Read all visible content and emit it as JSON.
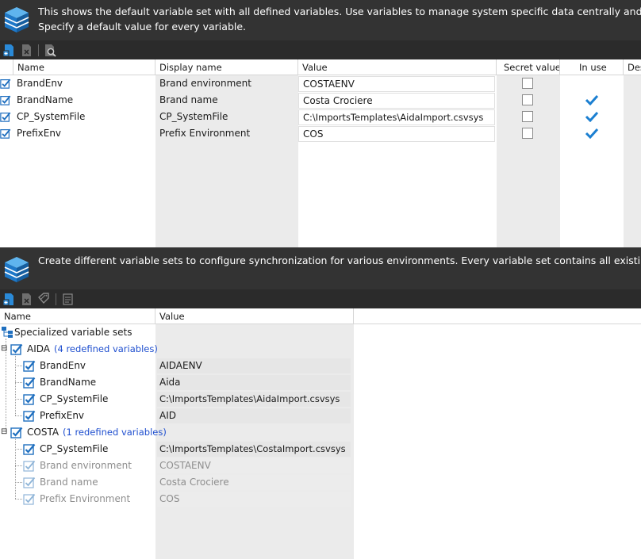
{
  "banner1": {
    "text_line1": "This shows the default variable set with all defined variables. Use variables to manage system specific data centrally and to pr",
    "text_line2": "Specify a default value for every variable."
  },
  "toolbar1": {
    "icons": [
      "add-variable-icon",
      "delete-variable-icon",
      "find-usages-icon"
    ]
  },
  "variables_table": {
    "columns": [
      "Name",
      "Display name",
      "Value",
      "Secret value",
      "In use",
      "Des"
    ],
    "rows": [
      {
        "name": "BrandEnv",
        "display_name": "Brand environment",
        "value": "COSTAENV",
        "secret": false,
        "in_use": false
      },
      {
        "name": "BrandName",
        "display_name": "Brand name",
        "value": "Costa Crociere",
        "secret": false,
        "in_use": true
      },
      {
        "name": "CP_SystemFile",
        "display_name": "CP_SystemFile",
        "value": "C:\\ImportsTemplates\\AidaImport.csvsys",
        "secret": false,
        "in_use": true
      },
      {
        "name": "PrefixEnv",
        "display_name": "Prefix Environment",
        "value": "COS",
        "secret": false,
        "in_use": true
      }
    ]
  },
  "banner2": {
    "text_line1": "Create different variable sets to configure synchronization for various environments. Every variable set contains all existing va"
  },
  "toolbar2": {
    "icons": [
      "add-set-icon",
      "delete-set-icon",
      "tag-icon",
      "edit-list-icon"
    ]
  },
  "sets_tree": {
    "columns": [
      "Name",
      "Value"
    ],
    "root_label": "Specialized variable sets",
    "sets": [
      {
        "name": "AIDA",
        "summary": "(4 redefined variables)",
        "items": [
          {
            "name": "BrandEnv",
            "value": "AIDAENV",
            "redefined": true
          },
          {
            "name": "BrandName",
            "value": "Aida",
            "redefined": true
          },
          {
            "name": "CP_SystemFile",
            "value": "C:\\ImportsTemplates\\AidaImport.csvsys",
            "redefined": true
          },
          {
            "name": "PrefixEnv",
            "value": "AID",
            "redefined": true
          }
        ]
      },
      {
        "name": "COSTA",
        "summary": "(1 redefined variables)",
        "items": [
          {
            "name": "CP_SystemFile",
            "value": "C:\\ImportsTemplates\\CostaImport.csvsys",
            "redefined": true
          },
          {
            "name": "Brand environment",
            "value": "COSTAENV",
            "redefined": false
          },
          {
            "name": "Brand name",
            "value": "Costa Crociere",
            "redefined": false
          },
          {
            "name": "Prefix Environment",
            "value": "COS",
            "redefined": false
          }
        ]
      }
    ]
  },
  "colors": {
    "banner_bg": "#333333",
    "toolbar_bg": "#2b2b2b",
    "accent_blue": "#1b7fd1",
    "link_blue": "#1f4fcf"
  }
}
